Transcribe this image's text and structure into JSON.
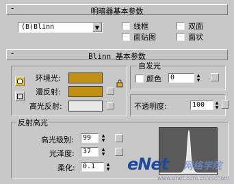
{
  "shader_rollout": {
    "title": "明暗器基本参数",
    "collapse_glyph": "-",
    "shader_select": "(B)Blinn",
    "options": [
      "线框",
      "双面",
      "面贴图",
      "面状"
    ]
  },
  "blinn_rollout": {
    "title": "Blinn 基本参数",
    "collapse_glyph": "-",
    "ambient_label": "环境光:",
    "diffuse_label": "漫反射:",
    "specular_label": "高光反射:",
    "ambient_color": "#c09010",
    "diffuse_color": "#c09010",
    "specular_color": "#e8e8e8",
    "lock_icon": "lock-icon",
    "self_illum": {
      "title": "自发光",
      "color_label": "颜色",
      "value": "0"
    },
    "opacity": {
      "label": "不透明度:",
      "value": "100"
    }
  },
  "specular_highlights": {
    "title": "反射高光",
    "level_label": "高光级别:",
    "level_value": "99",
    "gloss_label": "光泽度:",
    "gloss_value": "37",
    "soften_label": "柔化:",
    "soften_value": "0.1"
  },
  "watermark": {
    "brand": "eNet",
    "cn": "网络学院",
    "url": "www.enet.com.cn/eschool"
  }
}
